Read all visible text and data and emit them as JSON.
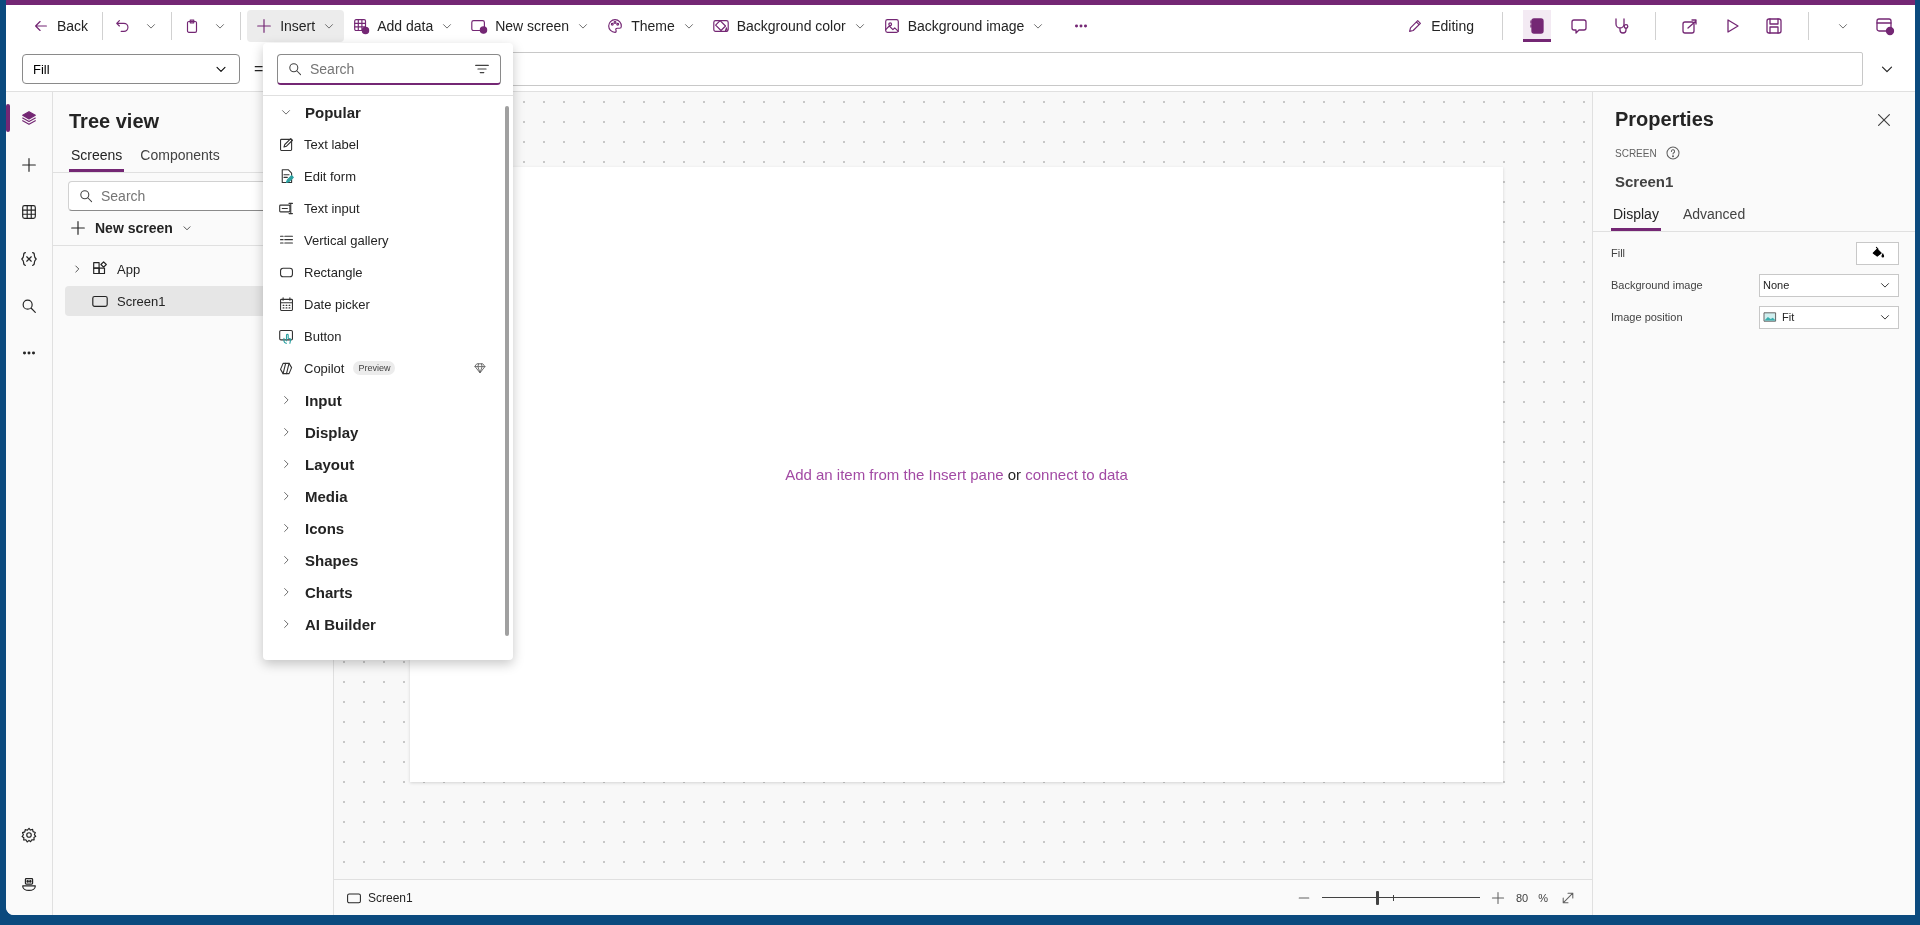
{
  "toolbar": {
    "buttons": [
      {
        "label": "Back",
        "dropdown": false,
        "expanded": false
      },
      {
        "label": "Insert",
        "dropdown": true,
        "expanded": true
      },
      {
        "label": "Add data",
        "dropdown": true,
        "expanded": false
      },
      {
        "label": "New screen",
        "dropdown": true,
        "expanded": false
      },
      {
        "label": "Theme",
        "dropdown": true,
        "expanded": false
      },
      {
        "label": "Background color",
        "dropdown": true,
        "expanded": false
      },
      {
        "label": "Background image",
        "dropdown": true,
        "expanded": false
      }
    ],
    "mode": "Editing",
    "right_icons": [
      {
        "selected": true
      },
      {
        "selected": false
      },
      {
        "selected": false
      },
      {
        "selected": false
      },
      {
        "selected": false
      },
      {
        "selected": false
      },
      {
        "selected": false
      }
    ]
  },
  "formula_bar": {
    "property": "Fill",
    "equals": "="
  },
  "rail": {
    "top": [
      {
        "selected": true
      },
      {
        "selected": false
      },
      {
        "selected": false
      },
      {
        "selected": false
      },
      {
        "selected": false
      },
      {
        "selected": false
      }
    ],
    "bottom": [
      {
        "selected": false
      },
      {
        "selected": false
      }
    ]
  },
  "tree": {
    "title": "Tree view",
    "tabs": [
      {
        "label": "Screens",
        "selected": true
      },
      {
        "label": "Components",
        "selected": false
      }
    ],
    "search": {
      "placeholder": "Search"
    },
    "new_screen": "New screen",
    "items": [
      {
        "kind": "app",
        "label": "App",
        "expanded": false,
        "selected": false
      },
      {
        "kind": "screen",
        "label": "Screen1",
        "selected": true
      }
    ]
  },
  "insert_pane": {
    "search": {
      "placeholder": "Search"
    },
    "categories": [
      {
        "label": "Popular",
        "expanded": true,
        "children": [
          {
            "label": "Text label",
            "premium": false
          },
          {
            "label": "Edit form",
            "premium": false
          },
          {
            "label": "Text input",
            "premium": false
          },
          {
            "label": "Vertical gallery",
            "premium": false
          },
          {
            "label": "Rectangle",
            "premium": false
          },
          {
            "label": "Date picker",
            "premium": false
          },
          {
            "label": "Button",
            "premium": false
          },
          {
            "label": "Copilot",
            "badge": "Preview",
            "premium": true
          }
        ]
      },
      {
        "label": "Input",
        "expanded": false
      },
      {
        "label": "Display",
        "expanded": false
      },
      {
        "label": "Layout",
        "expanded": false
      },
      {
        "label": "Media",
        "expanded": false
      },
      {
        "label": "Icons",
        "expanded": false
      },
      {
        "label": "Shapes",
        "expanded": false
      },
      {
        "label": "Charts",
        "expanded": false
      },
      {
        "label": "AI Builder",
        "expanded": false
      }
    ]
  },
  "canvas": {
    "hint": {
      "link": "Add an item from the Insert pane",
      "text": "or",
      "link2": "connect to data"
    }
  },
  "properties": {
    "title": "Properties",
    "type": "SCREEN",
    "name": "Screen1",
    "tabs": [
      {
        "label": "Display",
        "selected": true
      },
      {
        "label": "Advanced",
        "selected": false
      }
    ],
    "rows": [
      {
        "kind": "color",
        "label": "Fill"
      },
      {
        "kind": "dropdown",
        "label": "Background image",
        "value": "None"
      },
      {
        "kind": "image_dropdown",
        "label": "Image position",
        "value": "Fit"
      }
    ]
  },
  "status_bar": {
    "screen": "Screen1",
    "zoom": {
      "level": 0.35,
      "value": "80",
      "unit": "%"
    }
  }
}
